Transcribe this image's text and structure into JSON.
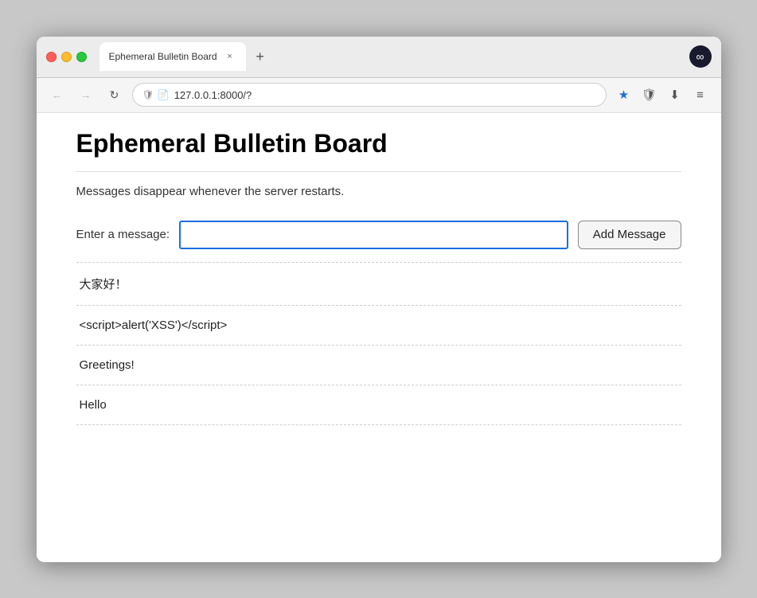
{
  "browser": {
    "tab": {
      "title": "Ephemeral Bulletin Board",
      "close_label": "×",
      "new_tab_label": "+"
    },
    "nav": {
      "back_arrow": "←",
      "forward_arrow": "→",
      "reload_icon": "↻",
      "address": "127.0.0.1:8000/?",
      "shield_icon": "🛡",
      "file_icon": "📄",
      "bookmark_icon": "★",
      "pocket_icon": "🛡",
      "download_icon": "⬇",
      "menu_icon": "≡"
    },
    "profile_icon": "∞"
  },
  "page": {
    "title": "Ephemeral Bulletin Board",
    "subtitle": "Messages disappear whenever the server restarts.",
    "form": {
      "label": "Enter a message:",
      "placeholder": "",
      "button_label": "Add Message"
    },
    "messages": [
      {
        "text": "大家好！"
      },
      {
        "text": "<script>alert('XSS')</script>"
      },
      {
        "text": "Greetings!"
      },
      {
        "text": "Hello"
      }
    ]
  }
}
